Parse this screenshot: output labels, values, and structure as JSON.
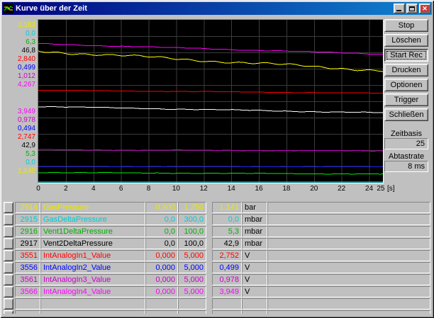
{
  "window": {
    "title": "Kurve über der Zeit",
    "close_glyph": "✕"
  },
  "toolbar": {
    "buttons": [
      {
        "label": "Stop",
        "pressed": false
      },
      {
        "label": "Löschen",
        "pressed": false
      },
      {
        "label": "Start Rec",
        "pressed": true
      },
      {
        "label": "Drucken",
        "pressed": false
      },
      {
        "label": "Optionen",
        "pressed": false
      },
      {
        "label": "Trigger",
        "pressed": false
      },
      {
        "label": "Schließen",
        "pressed": false
      }
    ]
  },
  "settings": {
    "zeitbasis_label": "Zeitbasis",
    "zeitbasis_value": "25",
    "abtastrate_label": "Abtastrate",
    "abtastrate_value": "8 ms"
  },
  "chart_data": {
    "type": "line",
    "background": "#000000",
    "x_unit_label": "[s]",
    "x_range": [
      0,
      25
    ],
    "x_ticks": [
      0,
      2,
      4,
      6,
      8,
      10,
      12,
      14,
      16,
      18,
      20,
      22,
      24,
      25
    ],
    "grid": {
      "h_divisions": 10,
      "color": "#3c3c3c"
    },
    "axis_labels_start": [
      {
        "text": "1,183",
        "color": "#e8e800"
      },
      {
        "text": "0,0",
        "color": "#00cccc"
      },
      {
        "text": "6,3",
        "color": "#00b000"
      },
      {
        "text": "46,8",
        "color": "#000000"
      },
      {
        "text": "2,840",
        "color": "#ff0000"
      },
      {
        "text": "0,499",
        "color": "#0000ff"
      },
      {
        "text": "1,012",
        "color": "#cc00cc"
      },
      {
        "text": "4,267",
        "color": "#ff00ff"
      }
    ],
    "axis_labels_current": [
      {
        "text": "3,949",
        "color": "#ff00ff"
      },
      {
        "text": "0,978",
        "color": "#cc00cc"
      },
      {
        "text": "0,494",
        "color": "#0000ff"
      },
      {
        "text": "2,747",
        "color": "#ff0000"
      },
      {
        "text": "42,9",
        "color": "#000000"
      },
      {
        "text": "5,3",
        "color": "#00b000"
      },
      {
        "text": "0,0",
        "color": "#00cccc"
      },
      {
        "text": "1,140",
        "color": "#e8e800"
      }
    ],
    "series": [
      {
        "name": "GasPressure",
        "color": "#ffff00",
        "y_min": 0.9,
        "y_max": 1.25,
        "start_value": 1.183,
        "end_value": 1.141,
        "noise": 1.6
      },
      {
        "name": "GasDeltaPressure",
        "color": "#00ffff",
        "y_min": 0,
        "y_max": 300,
        "start_value": 0.0,
        "end_value": 0.0,
        "noise": 0
      },
      {
        "name": "Vent1DeltaPressure",
        "color": "#00ee00",
        "y_min": 0,
        "y_max": 100,
        "start_value": 6.3,
        "end_value": 5.3,
        "noise": 0.3
      },
      {
        "name": "Vent2DeltaPressure",
        "color": "#ffffff",
        "y_min": 0,
        "y_max": 100,
        "start_value": 46.8,
        "end_value": 42.9,
        "noise": 0.5
      },
      {
        "name": "IntAnalogIn1_Value",
        "color": "#ff0000",
        "y_min": 0,
        "y_max": 5,
        "start_value": 2.84,
        "end_value": 2.747,
        "noise": 0.3
      },
      {
        "name": "IntAnalogIn2_Value",
        "color": "#2222ff",
        "y_min": 0,
        "y_max": 5,
        "start_value": 0.499,
        "end_value": 0.494,
        "noise": 0.2
      },
      {
        "name": "IntAnalogIn3_Value",
        "color": "#cc00cc",
        "y_min": 0,
        "y_max": 5,
        "start_value": 1.012,
        "end_value": 0.978,
        "noise": 0.35
      },
      {
        "name": "IntAnalogIn4_Value",
        "color": "#ff00ff",
        "y_min": 0,
        "y_max": 5,
        "start_value": 4.267,
        "end_value": 3.949,
        "noise": 0.5
      }
    ]
  },
  "table": {
    "unit_color": "#000000",
    "empty_row_count": 2,
    "rows": [
      {
        "id": "2914",
        "name": "GasPressure",
        "min": "0,900",
        "max": "1,250",
        "value": "1,141",
        "unit": "bar",
        "color": "#e8e800"
      },
      {
        "id": "2915",
        "name": "GasDeltaPressure",
        "min": "0,0",
        "max": "300,0",
        "value": "0,0",
        "unit": "mbar",
        "color": "#00cccc"
      },
      {
        "id": "2916",
        "name": "Vent1DeltaPressure",
        "min": "0,0",
        "max": "100,0",
        "value": "5,3",
        "unit": "mbar",
        "color": "#00b000"
      },
      {
        "id": "2917",
        "name": "Vent2DeltaPressure",
        "min": "0,0",
        "max": "100,0",
        "value": "42,9",
        "unit": "mbar",
        "color": "#000000"
      },
      {
        "id": "3551",
        "name": "IntAnalogIn1_Value",
        "min": "0,000",
        "max": "5,000",
        "value": "2,752",
        "unit": "V",
        "color": "#ff0000"
      },
      {
        "id": "3556",
        "name": "IntAnalogIn2_Value",
        "min": "0,000",
        "max": "5,000",
        "value": "0,499",
        "unit": "V",
        "color": "#0000ff"
      },
      {
        "id": "3561",
        "name": "IntAnalogIn3_Value",
        "min": "0,000",
        "max": "5,000",
        "value": "0,978",
        "unit": "V",
        "color": "#cc00cc"
      },
      {
        "id": "3566",
        "name": "IntAnalogIn4_Value",
        "min": "0,000",
        "max": "5,000",
        "value": "3,949",
        "unit": "V",
        "color": "#ff00ff"
      }
    ]
  }
}
